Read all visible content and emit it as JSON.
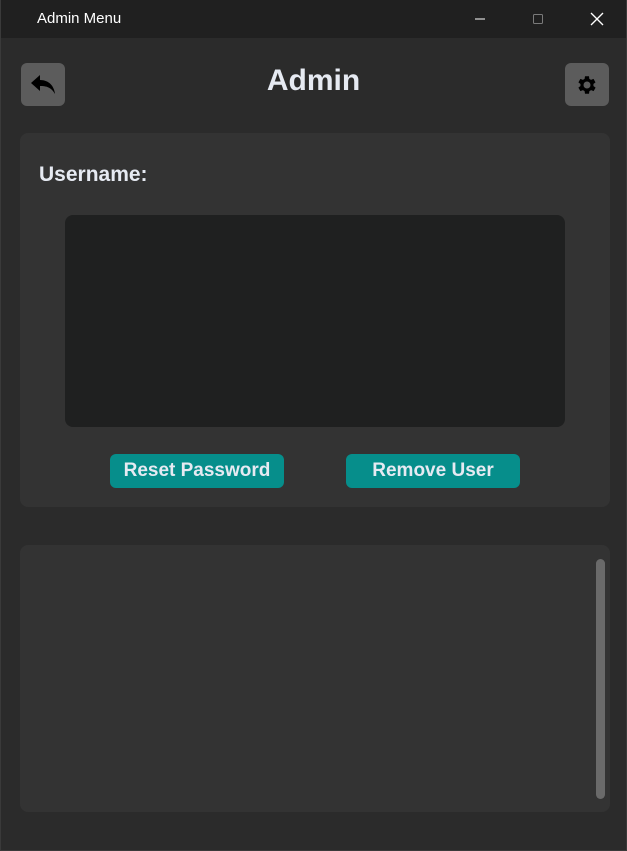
{
  "window": {
    "title": "Admin Menu"
  },
  "header": {
    "title": "Admin",
    "back_icon": "reply-arrow-icon",
    "settings_icon": "gear-icon"
  },
  "user_panel": {
    "username_label": "Username:",
    "reset_label": "Reset Password",
    "remove_label": "Remove User"
  },
  "colors": {
    "accent": "#068e8b",
    "background": "#2b2b2b",
    "card": "#333333",
    "list_bg": "#1f2020",
    "text": "#e6eaf2"
  }
}
